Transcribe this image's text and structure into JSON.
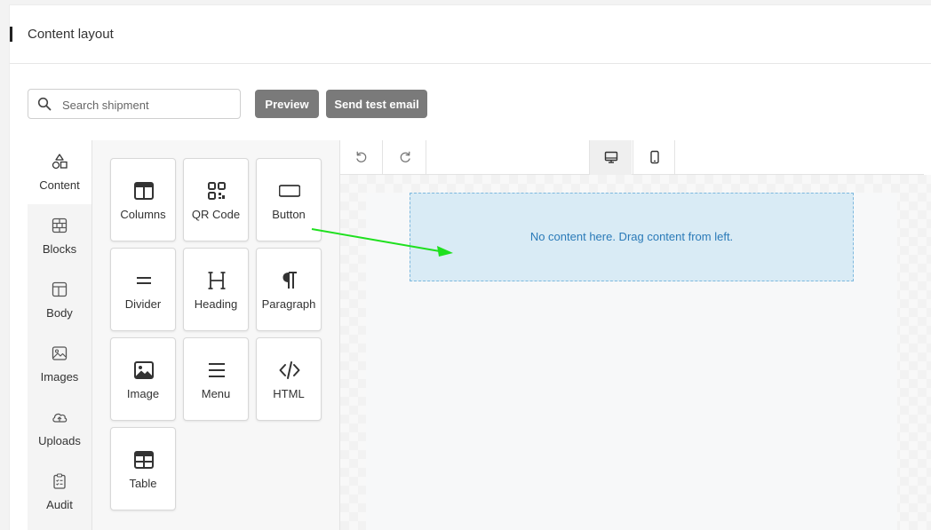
{
  "header": {
    "title": "Content layout"
  },
  "toolbar": {
    "search_placeholder": "Search shipment",
    "preview_label": "Preview",
    "send_test_label": "Send test email"
  },
  "tabs": [
    {
      "label": "Content",
      "icon": "shapes-icon",
      "active": true
    },
    {
      "label": "Blocks",
      "icon": "blocks-icon"
    },
    {
      "label": "Body",
      "icon": "layout-icon"
    },
    {
      "label": "Images",
      "icon": "images-icon"
    },
    {
      "label": "Uploads",
      "icon": "cloud-upload-icon"
    },
    {
      "label": "Audit",
      "icon": "clipboard-check-icon"
    }
  ],
  "tools": [
    {
      "label": "Columns",
      "icon": "columns-icon"
    },
    {
      "label": "QR Code",
      "icon": "qr-code-icon"
    },
    {
      "label": "Button",
      "icon": "button-icon"
    },
    {
      "label": "Divider",
      "icon": "divider-icon"
    },
    {
      "label": "Heading",
      "icon": "heading-icon"
    },
    {
      "label": "Paragraph",
      "icon": "paragraph-icon"
    },
    {
      "label": "Image",
      "icon": "image-icon"
    },
    {
      "label": "Menu",
      "icon": "menu-icon"
    },
    {
      "label": "HTML",
      "icon": "code-icon"
    },
    {
      "label": "Table",
      "icon": "table-icon"
    }
  ],
  "canvas": {
    "empty_message": "No content here. Drag content from left.",
    "active_view": "desktop"
  },
  "colors": {
    "button_bg": "#7a7a7a",
    "drop_zone_bg": "#d9ebf5",
    "drop_zone_text": "#2a7ab8",
    "annotation_arrow": "#1fe01f"
  }
}
